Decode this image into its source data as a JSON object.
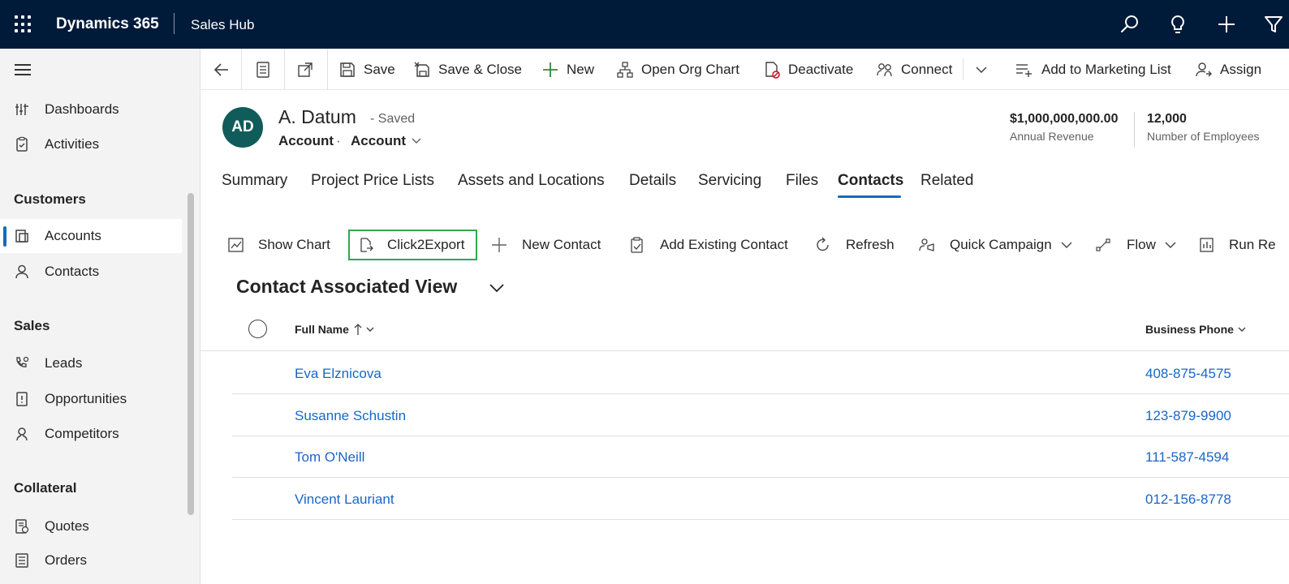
{
  "topbar": {
    "brand": "Dynamics 365",
    "app_name": "Sales Hub"
  },
  "sidebar": {
    "items_top": [
      {
        "label": "Dashboards",
        "icon": "dashboard-icon"
      },
      {
        "label": "Activities",
        "icon": "clipboard-icon"
      }
    ],
    "sections": [
      {
        "title": "Customers",
        "items": [
          {
            "label": "Accounts",
            "icon": "account-icon",
            "active": true
          },
          {
            "label": "Contacts",
            "icon": "person-icon"
          }
        ]
      },
      {
        "title": "Sales",
        "items": [
          {
            "label": "Leads",
            "icon": "phone-person-icon"
          },
          {
            "label": "Opportunities",
            "icon": "opportunity-icon"
          },
          {
            "label": "Competitors",
            "icon": "competitor-icon"
          }
        ]
      },
      {
        "title": "Collateral",
        "items": [
          {
            "label": "Quotes",
            "icon": "quote-icon"
          },
          {
            "label": "Orders",
            "icon": "order-icon"
          }
        ]
      }
    ]
  },
  "command_bar": {
    "save": "Save",
    "save_close": "Save & Close",
    "new": "New",
    "org_chart": "Open Org Chart",
    "deactivate": "Deactivate",
    "connect": "Connect",
    "marketing": "Add to Marketing List",
    "assign": "Assign"
  },
  "record": {
    "initials": "AD",
    "name": "A. Datum",
    "status": "- Saved",
    "entity": "Account",
    "dot": "·",
    "form": "Account",
    "kpis": [
      {
        "value": "$1,000,000,000.00",
        "label": "Annual Revenue"
      },
      {
        "value": "12,000",
        "label": "Number of Employees"
      }
    ]
  },
  "tabs": [
    "Summary",
    "Project Price Lists",
    "Assets and Locations",
    "Details",
    "Servicing",
    "Files",
    "Contacts",
    "Related"
  ],
  "subgrid_bar": {
    "show_chart": "Show Chart",
    "click2export": "Click2Export",
    "new_contact": "New Contact",
    "add_existing": "Add Existing Contact",
    "refresh": "Refresh",
    "quick_campaign": "Quick Campaign",
    "flow": "Flow",
    "run_report": "Run Re"
  },
  "view": {
    "title": "Contact Associated View",
    "columns": {
      "full_name": "Full Name",
      "phone": "Business Phone"
    },
    "rows": [
      {
        "name": "Eva Elznicova",
        "phone": "408-875-4575"
      },
      {
        "name": "Susanne Schustin",
        "phone": "123-879-9900"
      },
      {
        "name": "Tom O'Neill",
        "phone": "111-587-4594"
      },
      {
        "name": "Vincent Lauriant",
        "phone": "012-156-8778"
      }
    ]
  },
  "colors": {
    "topbar": "#001a3a",
    "accent": "#0f6cbd",
    "highlight": "#2fa84f",
    "link": "#1a66c9",
    "avatar": "#0f5c5a"
  }
}
